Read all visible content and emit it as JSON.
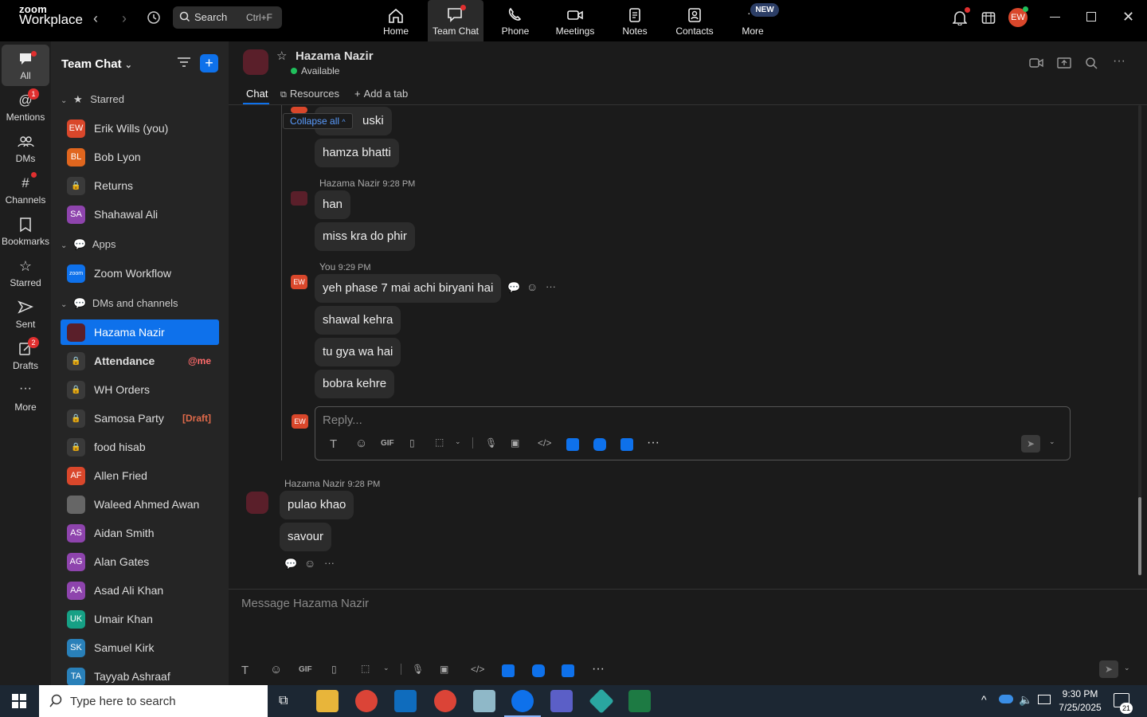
{
  "app": {
    "logo_line1": "zoom",
    "logo_line2": "Workplace"
  },
  "search": {
    "label": "Search",
    "shortcut": "Ctrl+F"
  },
  "topnav": [
    {
      "label": "Home"
    },
    {
      "label": "Team Chat"
    },
    {
      "label": "Phone"
    },
    {
      "label": "Meetings"
    },
    {
      "label": "Notes"
    },
    {
      "label": "Contacts"
    },
    {
      "label": "More"
    }
  ],
  "new_badge": "NEW",
  "user_initials": "EW",
  "rail": [
    {
      "label": "All"
    },
    {
      "label": "Mentions",
      "badge": "1"
    },
    {
      "label": "DMs"
    },
    {
      "label": "Channels"
    },
    {
      "label": "Bookmarks"
    },
    {
      "label": "Starred"
    },
    {
      "label": "Sent"
    },
    {
      "label": "Drafts",
      "badge": "2"
    },
    {
      "label": "More"
    }
  ],
  "sidebar": {
    "title": "Team Chat",
    "sections": {
      "starred": "Starred",
      "apps": "Apps",
      "dms": "DMs and channels"
    },
    "starred": [
      {
        "initials": "EW",
        "name": "Erik Wills (you)",
        "color": "#d9472b"
      },
      {
        "initials": "BL",
        "name": "Bob Lyon",
        "color": "#e0661e"
      },
      {
        "initials": "",
        "name": "Returns",
        "color": "#3a3a3a"
      },
      {
        "initials": "SA",
        "name": "Shahawal Ali",
        "color": "#8e44ad"
      }
    ],
    "apps": [
      {
        "initials": "zoom",
        "name": "Zoom Workflow",
        "color": "#0e71eb"
      }
    ],
    "dms": [
      {
        "initials": "",
        "name": "Hazama Nazir",
        "color": "#5a1f2a",
        "tag": ""
      },
      {
        "initials": "",
        "name": "Attendance",
        "color": "#3a3a3a",
        "tag": "@me"
      },
      {
        "initials": "",
        "name": "WH Orders",
        "color": "#3a3a3a",
        "tag": ""
      },
      {
        "initials": "",
        "name": "Samosa Party",
        "color": "#3a3a3a",
        "tag": "[Draft]"
      },
      {
        "initials": "",
        "name": "food hisab",
        "color": "#3a3a3a",
        "tag": ""
      },
      {
        "initials": "AF",
        "name": "Allen Fried",
        "color": "#d9472b",
        "tag": ""
      },
      {
        "initials": "",
        "name": "Waleed Ahmed Awan",
        "color": "#666",
        "tag": ""
      },
      {
        "initials": "AS",
        "name": "Aidan Smith",
        "color": "#8e44ad",
        "tag": ""
      },
      {
        "initials": "AG",
        "name": "Alan Gates",
        "color": "#8e44ad",
        "tag": ""
      },
      {
        "initials": "AA",
        "name": "Asad Ali Khan",
        "color": "#8e44ad",
        "tag": ""
      },
      {
        "initials": "UK",
        "name": "Umair Khan",
        "color": "#16a085",
        "tag": ""
      },
      {
        "initials": "SK",
        "name": "Samuel Kirk",
        "color": "#2980b9",
        "tag": ""
      },
      {
        "initials": "TA",
        "name": "Tayyab Ashraaf",
        "color": "#2980b9",
        "tag": ""
      }
    ]
  },
  "chat": {
    "name": "Hazama Nazir",
    "status": "Available",
    "tabs": {
      "chat": "Chat",
      "resources": "Resources",
      "add": "Add a tab"
    },
    "collapse_all": "Collapse all",
    "thread": {
      "partial_msg": "uski",
      "msg1": "hamza bhatti",
      "block1_sender": "Hazama Nazir",
      "block1_time": "9:28 PM",
      "block1_msgs": [
        "han",
        "miss kra do phir"
      ],
      "block2_sender": "You",
      "block2_time": "9:29 PM",
      "block2_msgs": [
        "yeh phase 7 mai achi biryani hai",
        "shawal kehra",
        "tu gya wa hai",
        "bobra kehre"
      ],
      "reply_placeholder": "Reply..."
    },
    "main_sender": "Hazama Nazir",
    "main_time": "9:28 PM",
    "main_msgs": [
      "pulao khao",
      "savour"
    ],
    "composer_placeholder": "Message Hazama Nazir",
    "gif": "GIF"
  },
  "taskbar": {
    "search_placeholder": "Type here to search",
    "time": "9:30 PM",
    "date": "7/25/2025",
    "notif_count": "21"
  }
}
